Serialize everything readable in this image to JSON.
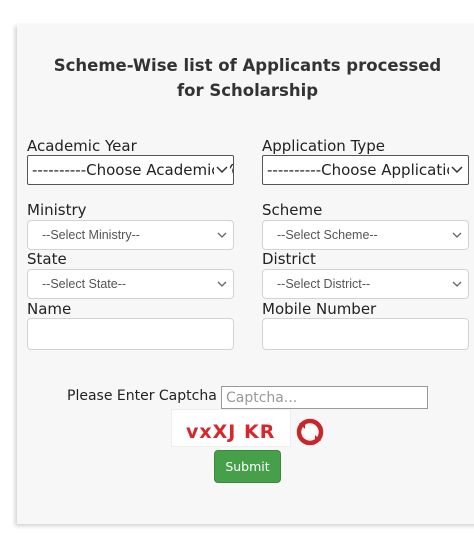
{
  "form": {
    "title": "Scheme-Wise list of Applicants processed for Scholarship",
    "academic_year": {
      "label": "Academic Year",
      "selected": "----------Choose Academic Year"
    },
    "application_type": {
      "label": "Application Type",
      "selected": "----------Choose Application Type"
    },
    "ministry": {
      "label": "Ministry",
      "selected": "--Select Ministry--"
    },
    "scheme": {
      "label": "Scheme",
      "selected": "--Select Scheme--"
    },
    "state": {
      "label": "State",
      "selected": "--Select State--"
    },
    "district": {
      "label": "District",
      "selected": "--Select District--"
    },
    "name": {
      "label": "Name",
      "value": ""
    },
    "mobile": {
      "label": "Mobile Number",
      "value": ""
    },
    "captcha": {
      "label": "Please Enter Captcha",
      "placeholder": "Captcha...",
      "image_text": "vxXJ KR",
      "refresh_icon": "refresh-icon"
    },
    "submit_label": "Submit"
  },
  "colors": {
    "submit_bg": "#45a049",
    "captcha_text": "#d9262b",
    "refresh_icon": "#c8262b"
  }
}
